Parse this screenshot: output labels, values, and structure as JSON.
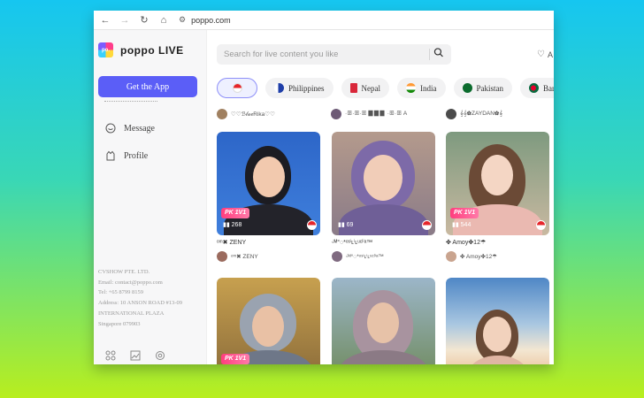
{
  "browser": {
    "url": "poppo.com"
  },
  "sidebar": {
    "logo_text": "poppo LIVE",
    "logo_mark": "po.",
    "get_app_label": "Get the App",
    "items": [
      {
        "label": "Message",
        "icon": "message-icon"
      },
      {
        "label": "Profile",
        "icon": "profile-icon"
      }
    ],
    "company_lines": [
      "CVSHOW PTE. LTD.",
      "Email: contact@poppo.com",
      "Tel: +65 8799 8159",
      "Address: 10 ANSON ROAD #13-09",
      "INTERNATIONAL PLAZA",
      "Singapore 079903"
    ],
    "bottom_icons": [
      "grid-icon",
      "image-icon",
      "settings-icon"
    ]
  },
  "header": {
    "search_placeholder": "Search for live content you like",
    "right_label": "A"
  },
  "countries": [
    {
      "label": "",
      "flag": "#e6252b",
      "active": true
    },
    {
      "label": "Philippines",
      "flag": "#1f3fa8"
    },
    {
      "label": "Nepal",
      "flag": "#d9273a"
    },
    {
      "label": "India",
      "flag": "#ff9933"
    },
    {
      "label": "Pakistan",
      "flag": "#0b6b2d"
    },
    {
      "label": "Banglade",
      "flag": "#0a6a3f"
    }
  ],
  "partial_row": [
    {
      "name": "♡♡ℬ𝓁𝓊𝑒Rika♡♡"
    },
    {
      "name": "·ꕥ·ꕥ·ꕥ ▊▊▊ ·ꕥ·ꕥ A"
    },
    {
      "name": "𝄞𝄞✿ZAYDAN✿𝄞"
    }
  ],
  "cards": [
    {
      "viewers": "268",
      "pk": "PK 1V1",
      "title": "ᵒᵐ✖ ZENY",
      "user": "ᵒᵐ✖ ZENY",
      "palette": "a"
    },
    {
      "viewers": "69",
      "pk": "",
      "title": "ᵕ̈ᴹ°◌*ᵒˢⁱʟⁱʟᵘᶜˡⁱᵃ™",
      "user": "ᵕ̈ᴹ°◌*ᵒˢⁱʟⁱʟᵘᶜˡⁱᵃ™",
      "palette": "b"
    },
    {
      "viewers": "544",
      "pk": "PK 1V1",
      "title": "✤ Amoy✤12☂",
      "user": "✤ Amoy✤12☂",
      "palette": "c"
    },
    {
      "viewers": "",
      "pk": "PK 1V1",
      "title": "",
      "user": "",
      "palette": "d"
    },
    {
      "viewers": "",
      "pk": "",
      "title": "",
      "user": "",
      "palette": "e"
    },
    {
      "viewers": "",
      "pk": "",
      "title": "",
      "user": "",
      "palette": "f"
    }
  ],
  "colors": {
    "accent": "#5b5ef7",
    "pk": "#ff3d7f"
  }
}
